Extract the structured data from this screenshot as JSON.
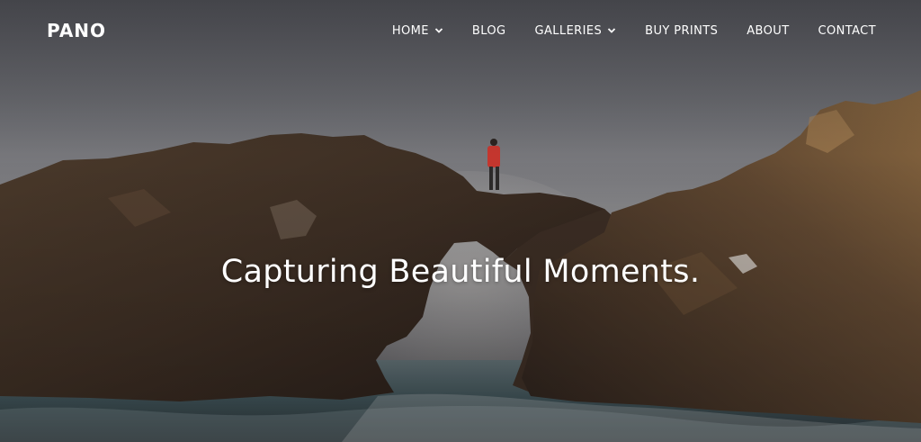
{
  "site": {
    "logo": "PANO"
  },
  "nav": {
    "items": [
      {
        "label": "HOME",
        "has_dropdown": true
      },
      {
        "label": "BLOG",
        "has_dropdown": false
      },
      {
        "label": "GALLERIES",
        "has_dropdown": true
      },
      {
        "label": "BUY PRINTS",
        "has_dropdown": false
      },
      {
        "label": "ABOUT",
        "has_dropdown": false
      },
      {
        "label": "CONTACT",
        "has_dropdown": false
      }
    ],
    "dropdown_icon": "chevron-down-icon"
  },
  "hero": {
    "headline": "Capturing Beautiful Moments.",
    "image_subject": "person standing on a rock arch over the sea"
  },
  "colors": {
    "text": "#ffffff",
    "rock": "#4a3a2c",
    "rock_highlight": "#8a6a44",
    "sea": "#3c5458"
  }
}
